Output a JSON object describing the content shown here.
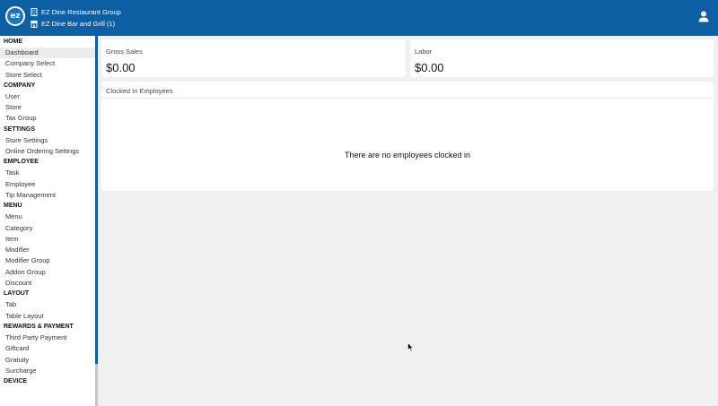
{
  "header": {
    "logo_text": "ez",
    "company": "EZ Dine Restaurant Group",
    "store": "EZ Dine Bar and Grill (1)"
  },
  "sidebar": {
    "sections": [
      {
        "title": "HOME",
        "items": [
          {
            "label": "Dashboard",
            "active": true
          },
          {
            "label": "Company Select"
          },
          {
            "label": "Store Select"
          }
        ]
      },
      {
        "title": "COMPANY",
        "items": [
          {
            "label": "User"
          },
          {
            "label": "Store"
          },
          {
            "label": "Tax Group"
          }
        ]
      },
      {
        "title": "SETTINGS",
        "items": [
          {
            "label": "Store Settings"
          },
          {
            "label": "Online Ordering Settings"
          }
        ]
      },
      {
        "title": "EMPLOYEE",
        "items": [
          {
            "label": "Task"
          },
          {
            "label": "Employee"
          },
          {
            "label": "Tip Management"
          }
        ]
      },
      {
        "title": "MENU",
        "items": [
          {
            "label": "Menu"
          },
          {
            "label": "Category"
          },
          {
            "label": "Item"
          },
          {
            "label": "Modifier"
          },
          {
            "label": "Modifier Group"
          },
          {
            "label": "Addon Group"
          },
          {
            "label": "Discount"
          }
        ]
      },
      {
        "title": "LAYOUT",
        "items": [
          {
            "label": "Tab"
          },
          {
            "label": "Table Layout"
          }
        ]
      },
      {
        "title": "REWARDS & PAYMENT",
        "items": [
          {
            "label": "Third Party Payment"
          },
          {
            "label": "Giftcard"
          },
          {
            "label": "Gratuity"
          },
          {
            "label": "Surcharge"
          }
        ]
      },
      {
        "title": "DEVICE",
        "items": []
      }
    ]
  },
  "dashboard": {
    "gross_sales": {
      "title": "Gross Sales",
      "value": "$0.00"
    },
    "labor": {
      "title": "Labor",
      "value": "$0.00"
    },
    "clocked_in": {
      "title": "Clocked In Employees",
      "empty_message": "There are no employees clocked in"
    }
  },
  "colors": {
    "header_bg": "#0d5fa3",
    "page_bg": "#f0f0f0",
    "active_item_bg": "#ececec"
  },
  "icons": {
    "logo": "ez-logo",
    "company": "building-icon",
    "store": "store-icon",
    "user": "user-icon"
  }
}
